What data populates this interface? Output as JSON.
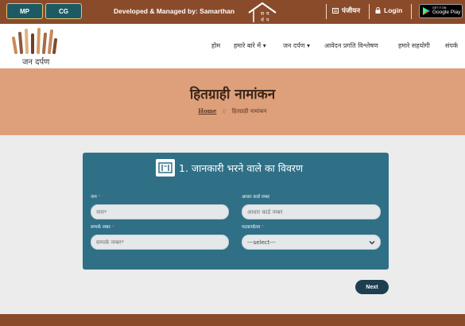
{
  "topbar": {
    "states": [
      "MP",
      "CG"
    ],
    "developed_by": "Developed & Managed by: Samarthan",
    "register_label": "पंजीयन",
    "login_label": "Login",
    "store_line1": "GET IT ON",
    "store_line2": "Google Play"
  },
  "nav": {
    "logo_text": "जन दर्पण",
    "items": [
      {
        "label": "होम"
      },
      {
        "label": "हमारे बारे में ▾"
      },
      {
        "label": "जन दर्पण ▾"
      },
      {
        "label": "आवेदन प्रगति विश्लेषण"
      },
      {
        "label": "हमारे सहयोगी"
      },
      {
        "label": "संपर्क"
      }
    ]
  },
  "banner": {
    "title": "हितग्राही नामांकन",
    "breadcrumb_home": "Home",
    "breadcrumb_sep": "//",
    "breadcrumb_current": "हितग्राही नामांकन"
  },
  "form": {
    "title": "1. जानकारी भरने वाले का विवरण",
    "name_label": "नाम",
    "name_placeholder": "नाम*",
    "aadhaar_label": "आधार कार्ड नम्बर",
    "aadhaar_placeholder": "आधार कार्ड नम्बर",
    "contact_label": "सम्पर्क नम्बर",
    "contact_placeholder": "सम्पर्क नम्बर*",
    "designation_label": "पदकार्यालय",
    "designation_value": "---select---",
    "required_mark": "*",
    "next_label": "Next"
  },
  "colors": {
    "topbar": "#8a4b2a",
    "banner": "#dda07a",
    "card": "#2f7087",
    "next_button": "#1d3f4f"
  }
}
